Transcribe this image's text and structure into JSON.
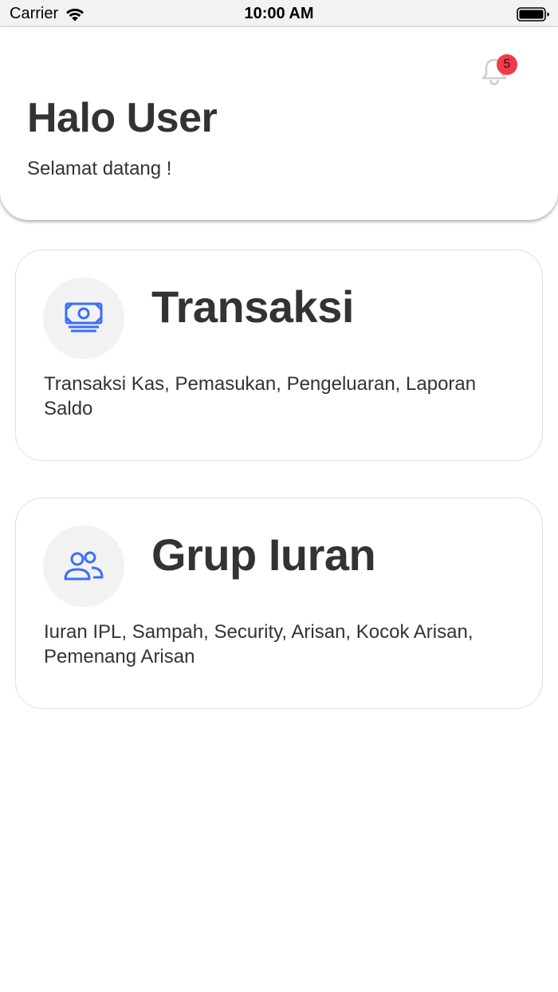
{
  "status_bar": {
    "carrier": "Carrier",
    "time": "10:00 AM"
  },
  "header": {
    "greeting": "Halo User",
    "subtitle": "Selamat datang !",
    "notification_count": "5"
  },
  "cards": [
    {
      "title": "Transaksi",
      "description": "Transaksi Kas, Pemasukan, Pengeluaran, Laporan Saldo",
      "icon": "cash-icon"
    },
    {
      "title": "Grup Iuran",
      "description": "Iuran IPL, Sampah, Security, Arisan, Kocok Arisan, Pemenang Arisan",
      "icon": "users-icon"
    }
  ],
  "colors": {
    "accent": "#3b6ff5",
    "badge": "#ef3b4b",
    "text": "#333333",
    "icon_bg": "#f2f2f2"
  }
}
